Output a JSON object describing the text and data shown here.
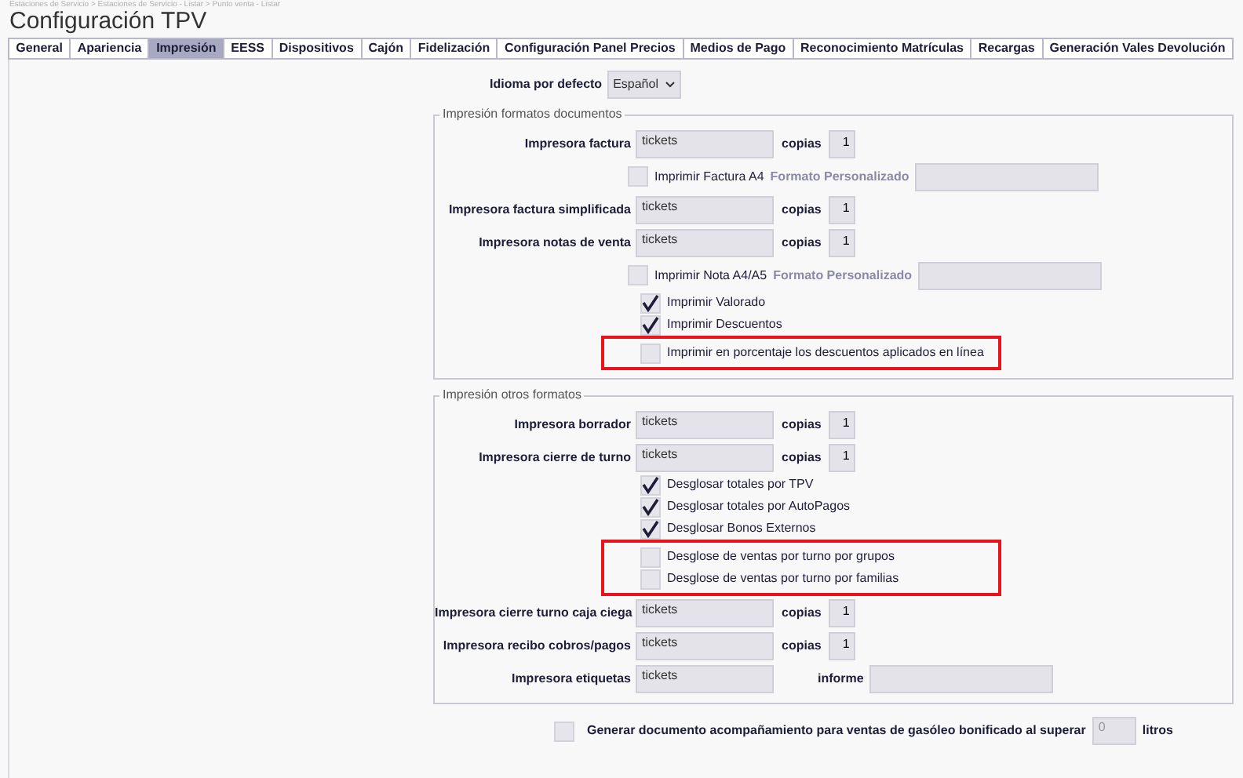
{
  "breadcrumb": "Estaciones de Servicio > Estaciones de Servicio - Listar > Punto venta - Listar",
  "title": "Configuración TPV",
  "tabs": [
    {
      "label": "General",
      "selected": false
    },
    {
      "label": "Apariencia",
      "selected": false
    },
    {
      "label": "Impresión",
      "selected": true
    },
    {
      "label": "EESS",
      "selected": false
    },
    {
      "label": "Dispositivos",
      "selected": false
    },
    {
      "label": "Cajón",
      "selected": false
    },
    {
      "label": "Fidelización",
      "selected": false
    },
    {
      "label": "Configuración Panel Precios",
      "selected": false
    },
    {
      "label": "Medios de Pago",
      "selected": false
    },
    {
      "label": "Reconocimiento Matrículas",
      "selected": false
    },
    {
      "label": "Recargas",
      "selected": false
    },
    {
      "label": "Generación Vales Devolución",
      "selected": false
    }
  ],
  "language": {
    "label": "Idioma por defecto",
    "value": "Español"
  },
  "sections": [
    {
      "legend": "Impresión formatos documentos",
      "items": [
        {
          "kind": "printer",
          "label": "Impresora factura",
          "value": "tickets",
          "copies_label": "copias",
          "copies": "1"
        },
        {
          "kind": "format",
          "label": "Imprimir Factura A4",
          "format_label": "Formato Personalizado",
          "checked": false,
          "highlighted": false
        },
        {
          "kind": "printer",
          "label": "Impresora factura simplificada",
          "value": "tickets",
          "copies_label": "copias",
          "copies": "1"
        },
        {
          "kind": "printer",
          "label": "Impresora notas de venta",
          "value": "tickets",
          "copies_label": "copias",
          "copies": "1"
        },
        {
          "kind": "format",
          "label": "Imprimir Nota A4/A5",
          "format_label": "Formato Personalizado",
          "checked": false,
          "highlighted": false
        },
        {
          "kind": "checkbox",
          "label": "Imprimir Valorado",
          "checked": true,
          "highlighted": false
        },
        {
          "kind": "checkbox",
          "label": "Imprimir Descuentos",
          "checked": true,
          "highlighted": false
        },
        {
          "kind": "checkbox",
          "label": "Imprimir en porcentaje los descuentos aplicados en línea",
          "checked": false,
          "highlighted": true
        }
      ]
    },
    {
      "legend": "Impresión otros formatos",
      "items": [
        {
          "kind": "printer",
          "label": "Impresora borrador",
          "value": "tickets",
          "copies_label": "copias",
          "copies": "1"
        },
        {
          "kind": "printer",
          "label": "Impresora cierre de turno",
          "value": "tickets",
          "copies_label": "copias",
          "copies": "1"
        },
        {
          "kind": "checkbox",
          "label": "Desglosar totales por TPV",
          "checked": true,
          "highlighted": false
        },
        {
          "kind": "checkbox",
          "label": "Desglosar totales por AutoPagos",
          "checked": true,
          "highlighted": false
        },
        {
          "kind": "checkbox",
          "label": "Desglosar Bonos Externos",
          "checked": true,
          "highlighted": false
        },
        {
          "kind": "checkbox",
          "label": "Desglose de ventas por turno por grupos",
          "checked": false,
          "highlighted": true
        },
        {
          "kind": "checkbox",
          "label": "Desglose de ventas por turno por familias",
          "checked": false,
          "highlighted": true
        },
        {
          "kind": "printer",
          "label": "Impresora cierre turno caja ciega",
          "value": "tickets",
          "copies_label": "copias",
          "copies": "1"
        },
        {
          "kind": "printer",
          "label": "Impresora recibo cobros/pagos",
          "value": "tickets",
          "copies_label": "copias",
          "copies": "1"
        },
        {
          "kind": "report",
          "label": "Impresora etiquetas",
          "value": "tickets",
          "report_label": "informe"
        }
      ]
    }
  ],
  "footer_option": {
    "label": "Generar documento acompañamiento para ventas de gasóleo bonificado al superar",
    "checked": false,
    "placeholder": "0",
    "unit": "litros"
  }
}
